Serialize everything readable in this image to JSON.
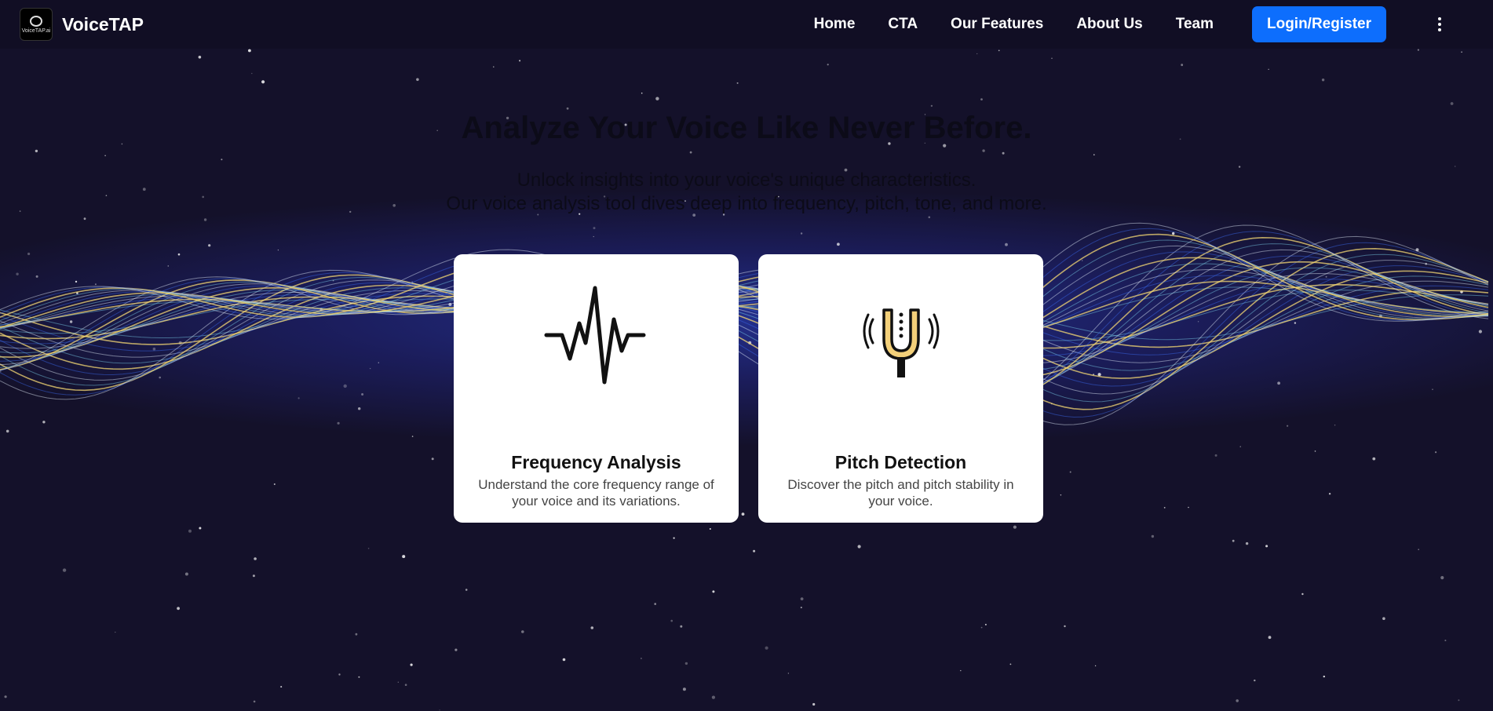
{
  "brand": {
    "logo_text": "VoiceTAP.ai",
    "name": "VoiceTAP"
  },
  "nav": {
    "links": [
      "Home",
      "CTA",
      "Our Features",
      "About Us",
      "Team"
    ],
    "login_label": "Login/Register",
    "menu_icon": "kebab-menu-icon"
  },
  "hero": {
    "title": "Analyze Your Voice Like Never Before.",
    "subtitle_line1": "Unlock insights into your voice's unique characteristics.",
    "subtitle_line2": "Our voice analysis tool dives deep into frequency, pitch, tone, and more."
  },
  "features": [
    {
      "icon": "waveform-icon",
      "title": "Frequency Analysis",
      "description": "Understand the core frequency range of your voice and its variations."
    },
    {
      "icon": "tuning-fork-icon",
      "title": "Pitch Detection",
      "description": "Discover the pitch and pitch stability in your voice."
    }
  ],
  "colors": {
    "background": "#14112a",
    "accent": "#0d6efd",
    "wave_blue": "#3b6cf5",
    "wave_cyan": "#7fd8f0",
    "wave_yellow": "#f3d773"
  }
}
